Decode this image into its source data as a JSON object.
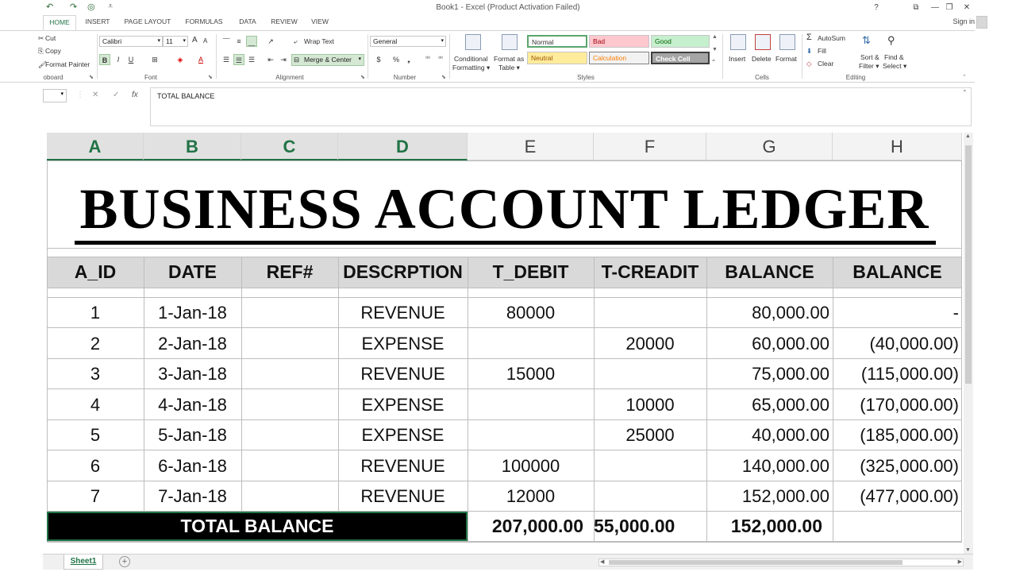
{
  "titlebar": {
    "title": "Book1 - Excel (Product Activation Failed)",
    "help": "?",
    "ribbon_display": "⧉",
    "minimize": "—",
    "restore": "❐",
    "close": "✕",
    "undo": "↶",
    "redo": "↷",
    "touch": "◎",
    "customize": "⩡"
  },
  "tabs": [
    "HOME",
    "INSERT",
    "PAGE LAYOUT",
    "FORMULAS",
    "DATA",
    "REVIEW",
    "VIEW"
  ],
  "signin": "Sign in",
  "ribbon": {
    "clipboard": {
      "cut": "Cut",
      "copy": "Copy",
      "format_painter": "Format Painter",
      "label": "oboard"
    },
    "font": {
      "name": "Calibri",
      "size": "11",
      "grow": "A",
      "shrink": "A",
      "bold": "B",
      "italic": "I",
      "underline": "U",
      "label": "Font",
      "font_color": "A",
      "fill": "◈",
      "borders": "⊞"
    },
    "alignment": {
      "wrap_text": "Wrap Text",
      "merge_center": "Merge & Center",
      "label": "Alignment"
    },
    "number": {
      "format": "General",
      "currency": "$",
      "percent": "%",
      "comma": "❟",
      "inc_decimal": "⁰⁰",
      "dec_decimal": "⁰⁰",
      "label": "Number"
    },
    "styles": {
      "conditional_formatting_1": "Conditional",
      "conditional_formatting_2": "Formatting ▾",
      "format_as_table_1": "Format as",
      "format_as_table_2": "Table ▾",
      "normal": "Normal",
      "bad": "Bad",
      "good": "Good",
      "neutral": "Neutral",
      "calculation": "Calculation",
      "check_cell": "Check Cell",
      "label": "Styles"
    },
    "cells": {
      "insert": "Insert",
      "delete": "Delete",
      "format": "Format",
      "label": "Cells"
    },
    "editing": {
      "autosum": "AutoSum",
      "fill": "Fill",
      "clear": "Clear",
      "sort_filter_1": "Sort &",
      "sort_filter_2": "Filter ▾",
      "find_select_1": "Find &",
      "find_select_2": "Select ▾",
      "label": "Editing"
    },
    "colors": {
      "normal_bg": "#ffffff",
      "bad_bg": "#ffc7ce",
      "bad_fg": "#9c0006",
      "good_bg": "#c6efce",
      "good_fg": "#006100",
      "neutral_bg": "#ffeb9c",
      "neutral_fg": "#9c5700",
      "calc_bg": "#f2f2f2",
      "calc_fg": "#fa7d00",
      "check_bg": "#a5a5a5",
      "check_fg": "#ffffff"
    }
  },
  "formula_bar": {
    "cancel": "✕",
    "enter": "✓",
    "fx": "fx",
    "value": "TOTAL BALANCE"
  },
  "sheet": {
    "columns": [
      "A",
      "B",
      "C",
      "D",
      "E",
      "F",
      "G",
      "H"
    ],
    "selected_columns": [
      "A",
      "B",
      "C",
      "D"
    ],
    "title": "BUSINESS ACCOUNT LEDGER",
    "headers": [
      "A_ID",
      "DATE",
      "REF#",
      "DESCRPTION",
      "T_DEBIT",
      "T-CREADIT",
      "BALANCE",
      "BALANCE"
    ],
    "rows": [
      {
        "id": "1",
        "date": "1-Jan-18",
        "ref": "",
        "desc": "REVENUE",
        "debit": "80000",
        "credit": "",
        "balance": "80,000.00",
        "balance2": "-"
      },
      {
        "id": "2",
        "date": "2-Jan-18",
        "ref": "",
        "desc": "EXPENSE",
        "debit": "",
        "credit": "20000",
        "balance": "60,000.00",
        "balance2": "(40,000.00)"
      },
      {
        "id": "3",
        "date": "3-Jan-18",
        "ref": "",
        "desc": "REVENUE",
        "debit": "15000",
        "credit": "",
        "balance": "75,000.00",
        "balance2": "(115,000.00)"
      },
      {
        "id": "4",
        "date": "4-Jan-18",
        "ref": "",
        "desc": "EXPENSE",
        "debit": "",
        "credit": "10000",
        "balance": "65,000.00",
        "balance2": "(170,000.00)"
      },
      {
        "id": "5",
        "date": "5-Jan-18",
        "ref": "",
        "desc": "EXPENSE",
        "debit": "",
        "credit": "25000",
        "balance": "40,000.00",
        "balance2": "(185,000.00)"
      },
      {
        "id": "6",
        "date": "6-Jan-18",
        "ref": "",
        "desc": "REVENUE",
        "debit": "100000",
        "credit": "",
        "balance": "140,000.00",
        "balance2": "(325,000.00)"
      },
      {
        "id": "7",
        "date": "7-Jan-18",
        "ref": "",
        "desc": "REVENUE",
        "debit": "12000",
        "credit": "",
        "balance": "152,000.00",
        "balance2": "(477,000.00)"
      }
    ],
    "total": {
      "label": "TOTAL BALANCE",
      "debit": "207,000.00",
      "credit": "55,000.00",
      "balance": "152,000.00"
    }
  },
  "sheet_tabs": {
    "active": "Sheet1",
    "add": "+"
  },
  "accent": "#217346"
}
